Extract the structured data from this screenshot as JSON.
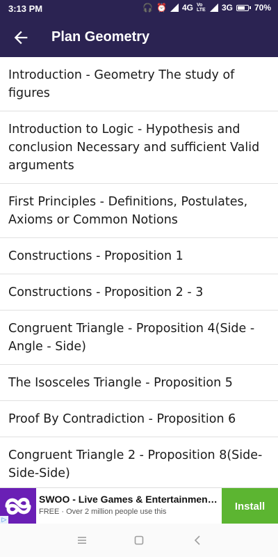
{
  "status_bar": {
    "time": "3:13 PM",
    "network_1": "4G",
    "network_2": "3G",
    "battery": "70%",
    "battery_level": 0.7,
    "volte": "Vo LTE"
  },
  "app_bar": {
    "title": "Plan Geometry",
    "back_icon": "arrow-back-icon",
    "background": "#2b2352"
  },
  "lessons": [
    "Introduction - Geometry The study of figures",
    "Introduction to Logic - Hypothesis and conclusion Necessary and sufficient Valid arguments",
    "First Principles - Definitions, Postulates, Axioms or Common Notions",
    "Constructions - Proposition 1",
    "Constructions - Proposition 2 - 3",
    "Congruent Triangle - Proposition 4(Side - Angle - Side)",
    "The Isosceles Triangle - Proposition 5",
    "Proof By Contradiction - Proposition 6",
    "Congruent Triangle 2 - Proposition 8(Side-Side-Side)"
  ],
  "ad": {
    "title": "SWOO - Live Games & Entertainment A...",
    "subtitle": "FREE · Over 2 million people use this",
    "install_label": "Install",
    "install_color": "#5cb531",
    "logo_color": "#6a1fb5"
  },
  "nav_bar": {
    "icons": [
      "menu-icon",
      "home-square-icon",
      "back-triangle-icon"
    ]
  }
}
